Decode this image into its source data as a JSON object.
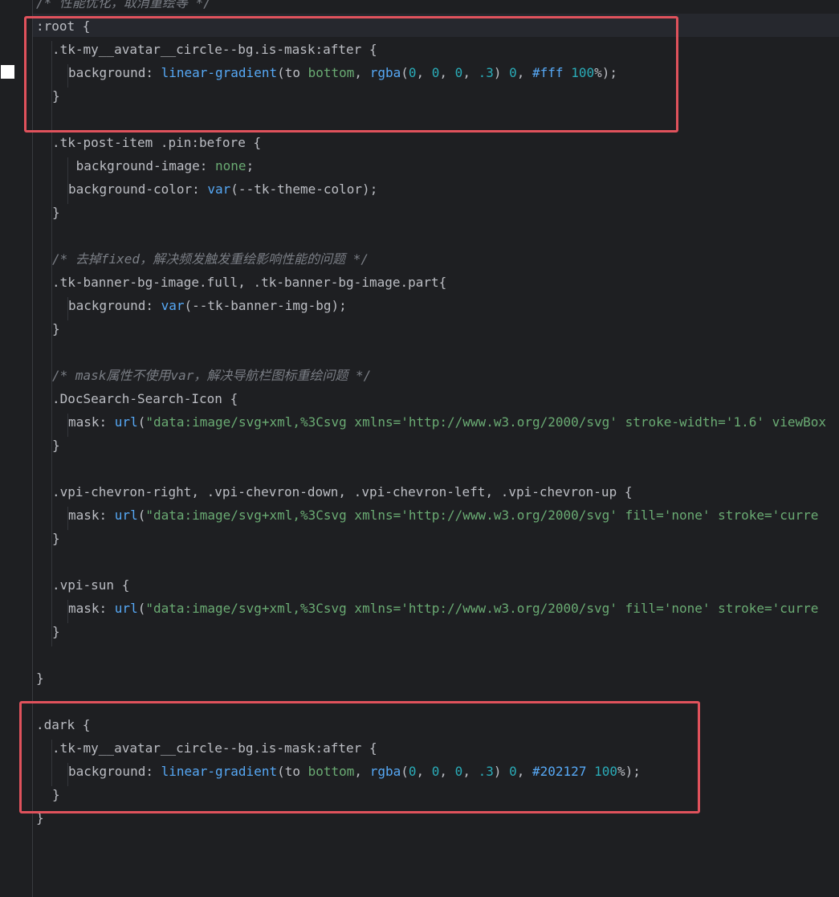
{
  "lines": [
    {
      "n": 0,
      "indent": 0,
      "tokens": [
        {
          "t": "com",
          "v": "/* 性能优化，取消重绘等 */"
        }
      ]
    },
    {
      "n": 1,
      "indent": 0,
      "tokens": [
        {
          "t": "sel",
          "v": ":root "
        },
        {
          "t": "punc",
          "v": "{"
        }
      ]
    },
    {
      "n": 2,
      "indent": 1,
      "tokens": [
        {
          "t": "sel",
          "v": ".tk-my__avatar__circle--bg.is-mask:after "
        },
        {
          "t": "punc",
          "v": "{"
        }
      ]
    },
    {
      "n": 3,
      "indent": 2,
      "tokens": [
        {
          "t": "prop",
          "v": "background: "
        },
        {
          "t": "fn",
          "v": "linear-gradient"
        },
        {
          "t": "punc",
          "v": "(to "
        },
        {
          "t": "kw",
          "v": "bottom"
        },
        {
          "t": "punc",
          "v": ", "
        },
        {
          "t": "fn",
          "v": "rgba"
        },
        {
          "t": "punc",
          "v": "("
        },
        {
          "t": "num",
          "v": "0"
        },
        {
          "t": "punc",
          "v": ", "
        },
        {
          "t": "num",
          "v": "0"
        },
        {
          "t": "punc",
          "v": ", "
        },
        {
          "t": "num",
          "v": "0"
        },
        {
          "t": "punc",
          "v": ", "
        },
        {
          "t": "num",
          "v": ".3"
        },
        {
          "t": "punc",
          "v": ") "
        },
        {
          "t": "num",
          "v": "0"
        },
        {
          "t": "punc",
          "v": ", "
        },
        {
          "t": "hex",
          "v": "#fff"
        },
        {
          "t": "punc",
          "v": " "
        },
        {
          "t": "num",
          "v": "100"
        },
        {
          "t": "punc",
          "v": "%);"
        }
      ]
    },
    {
      "n": 4,
      "indent": 1,
      "tokens": [
        {
          "t": "punc",
          "v": "}"
        }
      ]
    },
    {
      "n": 5,
      "indent": 0,
      "tokens": []
    },
    {
      "n": 6,
      "indent": 1,
      "tokens": [
        {
          "t": "sel",
          "v": ".tk-post-item .pin:before "
        },
        {
          "t": "punc",
          "v": "{"
        }
      ]
    },
    {
      "n": 7,
      "indent": 2,
      "tokens": [
        {
          "t": "prop",
          "v": " background-image: "
        },
        {
          "t": "kw",
          "v": "none"
        },
        {
          "t": "punc",
          "v": ";"
        }
      ]
    },
    {
      "n": 8,
      "indent": 2,
      "tokens": [
        {
          "t": "prop",
          "v": "background-color: "
        },
        {
          "t": "fn",
          "v": "var"
        },
        {
          "t": "punc",
          "v": "(--tk-theme-color);"
        }
      ]
    },
    {
      "n": 9,
      "indent": 1,
      "tokens": [
        {
          "t": "punc",
          "v": "}"
        }
      ]
    },
    {
      "n": 10,
      "indent": 0,
      "tokens": []
    },
    {
      "n": 11,
      "indent": 1,
      "tokens": [
        {
          "t": "com",
          "v": "/* 去掉fixed，解决频发触发重绘影响性能的问题 */"
        }
      ]
    },
    {
      "n": 12,
      "indent": 1,
      "tokens": [
        {
          "t": "sel",
          "v": ".tk-banner-bg-image.full, .tk-banner-bg-image.part"
        },
        {
          "t": "punc",
          "v": "{"
        }
      ]
    },
    {
      "n": 13,
      "indent": 2,
      "tokens": [
        {
          "t": "prop",
          "v": "background: "
        },
        {
          "t": "fn",
          "v": "var"
        },
        {
          "t": "punc",
          "v": "(--tk-banner-img-bg);"
        }
      ]
    },
    {
      "n": 14,
      "indent": 1,
      "tokens": [
        {
          "t": "punc",
          "v": "}"
        }
      ]
    },
    {
      "n": 15,
      "indent": 0,
      "tokens": []
    },
    {
      "n": 16,
      "indent": 1,
      "tokens": [
        {
          "t": "com",
          "v": "/* mask属性不使用var，解决导航栏图标重绘问题 */"
        }
      ]
    },
    {
      "n": 17,
      "indent": 1,
      "tokens": [
        {
          "t": "sel",
          "v": ".DocSearch-Search-Icon "
        },
        {
          "t": "punc",
          "v": "{"
        }
      ]
    },
    {
      "n": 18,
      "indent": 2,
      "tokens": [
        {
          "t": "prop",
          "v": "mask: "
        },
        {
          "t": "fn",
          "v": "url"
        },
        {
          "t": "punc",
          "v": "("
        },
        {
          "t": "str",
          "v": "\"data:image/svg+xml,%3Csvg xmlns='http://www.w3.org/2000/svg' stroke-width='1.6' viewBox"
        }
      ]
    },
    {
      "n": 19,
      "indent": 1,
      "tokens": [
        {
          "t": "punc",
          "v": "}"
        }
      ]
    },
    {
      "n": 20,
      "indent": 0,
      "tokens": []
    },
    {
      "n": 21,
      "indent": 1,
      "tokens": [
        {
          "t": "sel",
          "v": ".vpi-chevron-right, .vpi-chevron-down, .vpi-chevron-left, .vpi-chevron-up "
        },
        {
          "t": "punc",
          "v": "{"
        }
      ]
    },
    {
      "n": 22,
      "indent": 2,
      "tokens": [
        {
          "t": "prop",
          "v": "mask: "
        },
        {
          "t": "fn",
          "v": "url"
        },
        {
          "t": "punc",
          "v": "("
        },
        {
          "t": "str",
          "v": "\"data:image/svg+xml,%3Csvg xmlns='http://www.w3.org/2000/svg' fill='none' stroke='curre"
        }
      ]
    },
    {
      "n": 23,
      "indent": 1,
      "tokens": [
        {
          "t": "punc",
          "v": "}"
        }
      ]
    },
    {
      "n": 24,
      "indent": 0,
      "tokens": []
    },
    {
      "n": 25,
      "indent": 1,
      "tokens": [
        {
          "t": "sel",
          "v": ".vpi-sun "
        },
        {
          "t": "punc",
          "v": "{"
        }
      ]
    },
    {
      "n": 26,
      "indent": 2,
      "tokens": [
        {
          "t": "prop",
          "v": "mask: "
        },
        {
          "t": "fn",
          "v": "url"
        },
        {
          "t": "punc",
          "v": "("
        },
        {
          "t": "str",
          "v": "\"data:image/svg+xml,%3Csvg xmlns='http://www.w3.org/2000/svg' fill='none' stroke='curre"
        }
      ]
    },
    {
      "n": 27,
      "indent": 1,
      "tokens": [
        {
          "t": "punc",
          "v": "}"
        }
      ]
    },
    {
      "n": 28,
      "indent": 0,
      "tokens": []
    },
    {
      "n": 29,
      "indent": 0,
      "tokens": [
        {
          "t": "punc",
          "v": "}"
        }
      ]
    },
    {
      "n": 30,
      "indent": 0,
      "tokens": []
    },
    {
      "n": 31,
      "indent": 0,
      "tokens": [
        {
          "t": "sel",
          "v": ".dark "
        },
        {
          "t": "punc",
          "v": "{"
        }
      ]
    },
    {
      "n": 32,
      "indent": 1,
      "tokens": [
        {
          "t": "sel",
          "v": ".tk-my__avatar__circle--bg.is-mask:after "
        },
        {
          "t": "punc",
          "v": "{"
        }
      ]
    },
    {
      "n": 33,
      "indent": 2,
      "tokens": [
        {
          "t": "prop",
          "v": "background: "
        },
        {
          "t": "fn",
          "v": "linear-gradient"
        },
        {
          "t": "punc",
          "v": "(to "
        },
        {
          "t": "kw",
          "v": "bottom"
        },
        {
          "t": "punc",
          "v": ", "
        },
        {
          "t": "fn",
          "v": "rgba"
        },
        {
          "t": "punc",
          "v": "("
        },
        {
          "t": "num",
          "v": "0"
        },
        {
          "t": "punc",
          "v": ", "
        },
        {
          "t": "num",
          "v": "0"
        },
        {
          "t": "punc",
          "v": ", "
        },
        {
          "t": "num",
          "v": "0"
        },
        {
          "t": "punc",
          "v": ", "
        },
        {
          "t": "num",
          "v": ".3"
        },
        {
          "t": "punc",
          "v": ") "
        },
        {
          "t": "num",
          "v": "0"
        },
        {
          "t": "punc",
          "v": ", "
        },
        {
          "t": "hex",
          "v": "#202127"
        },
        {
          "t": "punc",
          "v": " "
        },
        {
          "t": "num",
          "v": "100"
        },
        {
          "t": "punc",
          "v": "%);"
        }
      ]
    },
    {
      "n": 34,
      "indent": 1,
      "tokens": [
        {
          "t": "punc",
          "v": "}"
        }
      ]
    },
    {
      "n": 35,
      "indent": 0,
      "tokens": [
        {
          "t": "punc",
          "v": "}"
        }
      ]
    }
  ],
  "colors": {
    "background": "#1e1f22",
    "highlight_box": "#e0525c",
    "comment": "#7a7e85",
    "function": "#56a8f5",
    "keyword": "#6aab73",
    "number": "#2aacb8"
  }
}
